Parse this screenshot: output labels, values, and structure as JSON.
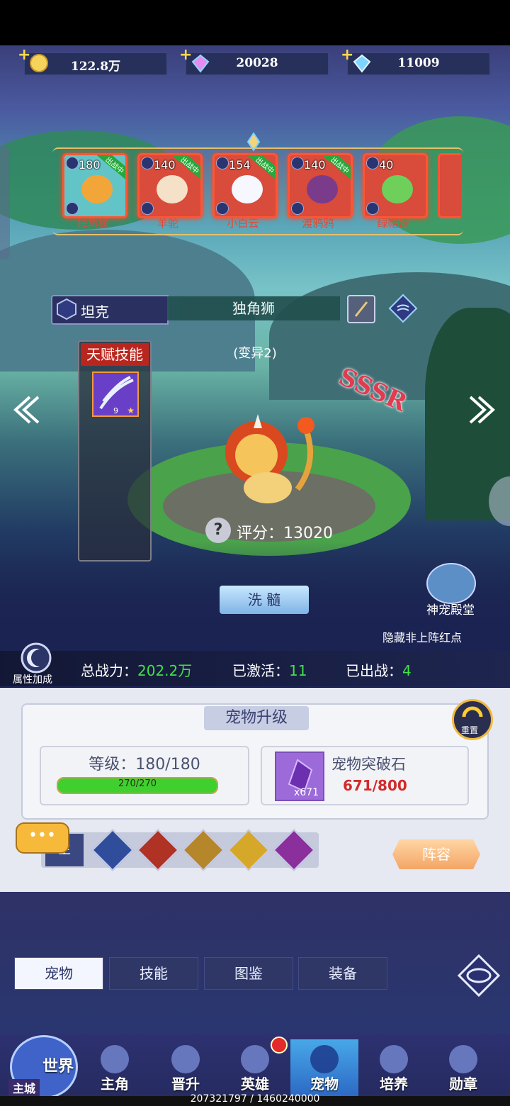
{
  "currencies": [
    {
      "icon": "gold-coin-icon",
      "value": "122.8万"
    },
    {
      "icon": "rainbow-gem-icon",
      "value": "20028"
    },
    {
      "icon": "blue-diamond-icon",
      "value": "11009"
    }
  ],
  "pets": [
    {
      "level": "180",
      "badge": "出战中",
      "name": "独角狮"
    },
    {
      "level": "140",
      "badge": "出战中",
      "name": "羊驼"
    },
    {
      "level": "154",
      "badge": "出战中",
      "name": "小白云"
    },
    {
      "level": "140",
      "badge": "出战中",
      "name": "渡鸦鸦"
    },
    {
      "level": "40",
      "badge": "",
      "name": "绿帽妖"
    }
  ],
  "pet_info": {
    "role": "坦克",
    "name": "独角狮",
    "variant": "(变异2)",
    "rarity": "SSSR",
    "score_label": "评分：13020",
    "wash_button": "洗 髓",
    "temple_label": "神宠殿堂",
    "hide_red_dot": "隐藏非上阵红点"
  },
  "talent": {
    "title": "天赋技能",
    "skill_level": "9"
  },
  "stats_bar": {
    "attr_bonus": "属性加成",
    "power_label": "总战力：",
    "power_value": "202.2万",
    "activated_label": "已激活：",
    "activated_value": "11",
    "deployed_label": "已出战：",
    "deployed_value": "4"
  },
  "upgrade": {
    "title": "宠物升级",
    "reset": "重置",
    "level_label": "等级：180/180",
    "exp_text": "270/270",
    "exp_fraction": 1.0,
    "item_name": "宠物突破石",
    "item_count": "x671",
    "item_progress": "671/800"
  },
  "element_filter": {
    "first": "主",
    "formation_button": "阵容"
  },
  "tabs": [
    "宠物",
    "技能",
    "图鉴",
    "装备"
  ],
  "nav": {
    "world": "世界",
    "main_city": "主城",
    "items": [
      "主角",
      "晋升",
      "英雄",
      "宠物",
      "培养",
      "勋章"
    ]
  },
  "footer_text": "207321797 / 1460240000",
  "colors": {
    "accent_green": "#43e04a",
    "rarity_red": "#e23b4f",
    "exp_bar": "#3fcf2e"
  }
}
